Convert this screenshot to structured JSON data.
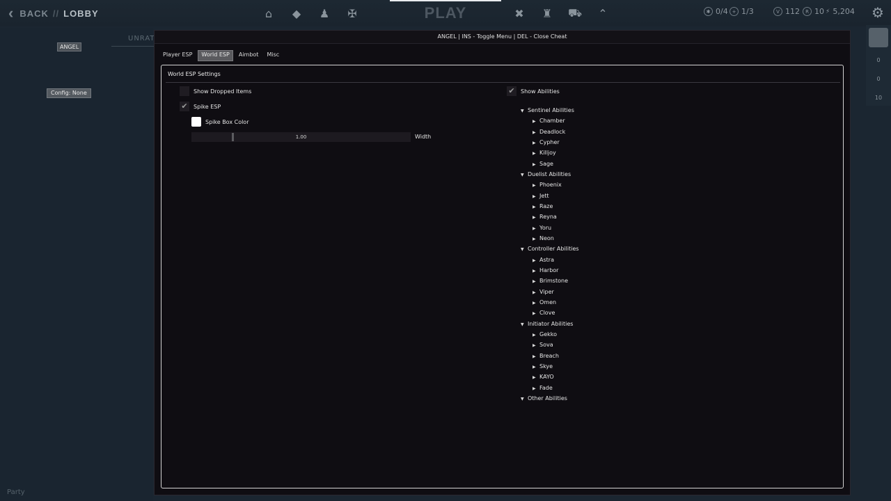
{
  "background": {
    "nav": {
      "back": "BACK",
      "separator": "//",
      "lobby": "LOBBY",
      "play": "PLAY"
    },
    "nav_icons": [
      "home-icon",
      "career-icon",
      "agents-icon",
      "collection-icon"
    ],
    "nav_icons_right": [
      "battlepass-icon",
      "store-icon",
      "shop-cart-icon",
      "rank-icon"
    ],
    "currency": {
      "party": "0/4",
      "friends": "1/3",
      "vp": "112",
      "radianite": "10",
      "kingdom": "5,204"
    },
    "angel_badge": "ANGEL",
    "config_badge": "Config: None",
    "mode_tab": "UNRATED",
    "party_label": "Party",
    "rail": {
      "values": [
        "0",
        "0",
        "10"
      ]
    }
  },
  "menu": {
    "title": "ANGEL | INS - Toggle Menu | DEL - Close Cheat",
    "tabs": [
      {
        "label": "Player ESP",
        "active": false
      },
      {
        "label": "World ESP",
        "active": true
      },
      {
        "label": "Aimbot",
        "active": false
      },
      {
        "label": "Misc",
        "active": false
      }
    ],
    "group_title": "World ESP Settings",
    "left": {
      "show_dropped_items": {
        "label": "Show Dropped Items",
        "checked": false
      },
      "spike_esp": {
        "label": "Spike ESP",
        "checked": true
      },
      "spike_box_color": {
        "label": "Spike Box Color",
        "color": "#ffffff"
      },
      "width_slider": {
        "value": "1.00",
        "label": "Width"
      }
    },
    "right": {
      "show_abilities": {
        "label": "Show Abilities",
        "checked": true
      },
      "tree": [
        {
          "category": "Sentinel Abilities",
          "agents": [
            "Chamber",
            "Deadlock",
            "Cypher",
            "Killjoy",
            "Sage"
          ]
        },
        {
          "category": "Duelist Abilities",
          "agents": [
            "Phoenix",
            "Jett",
            "Raze",
            "Reyna",
            "Yoru",
            "Neon"
          ]
        },
        {
          "category": "Controller Abilities",
          "agents": [
            "Astra",
            "Harbor",
            "Brimstone",
            "Viper",
            "Omen",
            "Clove"
          ]
        },
        {
          "category": "Initiator Abilities",
          "agents": [
            "Gekko",
            "Sova",
            "Breach",
            "Skye",
            "KAYO",
            "Fade"
          ]
        },
        {
          "category": "Other Abilities",
          "agents": []
        }
      ]
    }
  }
}
